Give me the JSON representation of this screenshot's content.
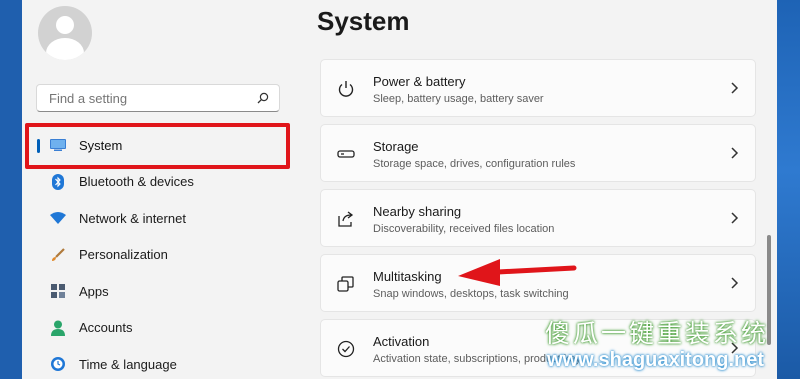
{
  "sidebar": {
    "search": {
      "placeholder": "Find a setting"
    },
    "items": [
      {
        "label": "System",
        "icon": "monitor-icon",
        "active": true
      },
      {
        "label": "Bluetooth & devices",
        "icon": "bluetooth-icon"
      },
      {
        "label": "Network & internet",
        "icon": "wifi-icon"
      },
      {
        "label": "Personalization",
        "icon": "brush-icon"
      },
      {
        "label": "Apps",
        "icon": "apps-icon"
      },
      {
        "label": "Accounts",
        "icon": "accounts-icon"
      },
      {
        "label": "Time & language",
        "icon": "globe-clock-icon"
      }
    ]
  },
  "main": {
    "title": "System",
    "cards": [
      {
        "title": "Power & battery",
        "subtitle": "Sleep, battery usage, battery saver",
        "icon": "power-icon"
      },
      {
        "title": "Storage",
        "subtitle": "Storage space, drives, configuration rules",
        "icon": "storage-icon"
      },
      {
        "title": "Nearby sharing",
        "subtitle": "Discoverability, received files location",
        "icon": "share-icon"
      },
      {
        "title": "Multitasking",
        "subtitle": "Snap windows, desktops, task switching",
        "icon": "multitasking-icon"
      },
      {
        "title": "Activation",
        "subtitle": "Activation state, subscriptions, product key",
        "icon": "activation-icon"
      }
    ]
  },
  "watermark": {
    "text": "傻瓜一键重装系统",
    "url": "www.shaguaxitong.net"
  },
  "colors": {
    "accent": "#005fb8",
    "highlight": "#e0151a"
  }
}
